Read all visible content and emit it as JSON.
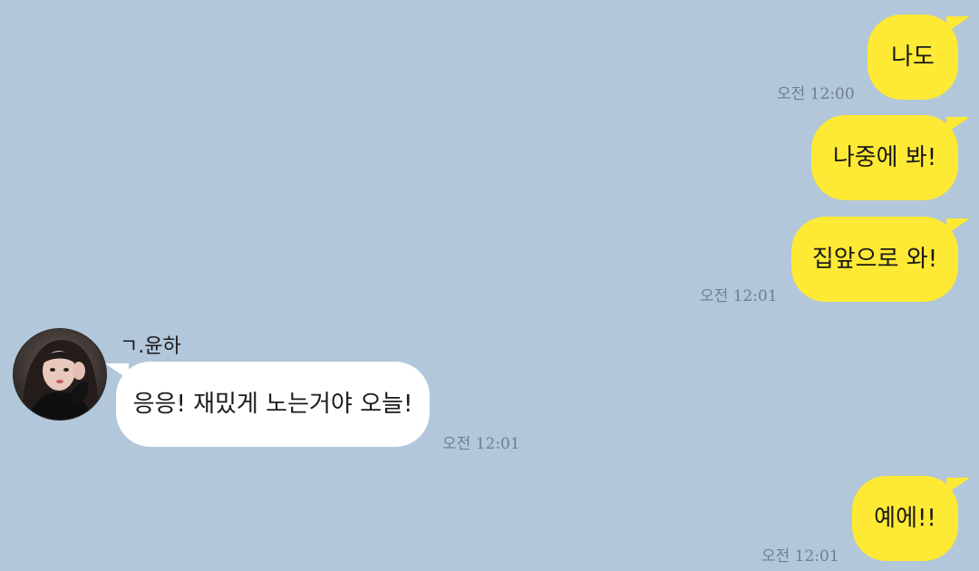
{
  "chat": {
    "messages": [
      {
        "id": "m1",
        "direction": "sent",
        "text": "나도",
        "time": "오전 12:00"
      },
      {
        "id": "m2",
        "direction": "sent",
        "text": "나중에 봐!",
        "time": ""
      },
      {
        "id": "m3",
        "direction": "sent",
        "text": "집앞으로 와!",
        "time": "오전 12:01"
      },
      {
        "id": "m4",
        "direction": "received",
        "sender": "ㄱ.윤하",
        "text": "응응! 재밌게 노는거야 오늘!",
        "time": "오전 12:01"
      },
      {
        "id": "m5",
        "direction": "sent",
        "text": "예에!!",
        "time": "오전 12:01"
      }
    ]
  },
  "icons": {
    "avatar": "profile-photo"
  },
  "colors": {
    "background": "#b2c7da",
    "sent_bubble": "#fee934",
    "received_bubble": "#ffffff",
    "timestamp": "#6f7f8f"
  }
}
